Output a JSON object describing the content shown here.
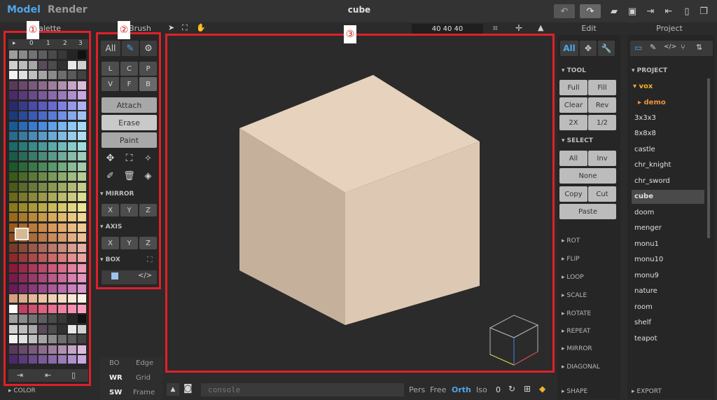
{
  "topbar": {
    "tab_model": "Model",
    "tab_render": "Render",
    "title": "cube"
  },
  "panels": {
    "palette": "Palette",
    "brush": "Brush",
    "edit": "Edit",
    "project": "Project"
  },
  "palette": {
    "tabs": [
      "▸",
      "0",
      "1",
      "2",
      "3"
    ],
    "bottom_label": "COLOR"
  },
  "brush": {
    "filter_all": "All",
    "modes": [
      "L",
      "C",
      "P",
      "V",
      "F",
      "B"
    ],
    "actions": [
      "Attach",
      "Erase",
      "Paint"
    ],
    "mirror_label": "MIRROR",
    "axis_label": "AXIS",
    "box_label": "BOX",
    "xyz": [
      "X",
      "Y",
      "Z"
    ]
  },
  "viewport": {
    "size_readout": "40  40  40"
  },
  "bottom_left": {
    "bo": "BO",
    "edge": "Edge",
    "wr": "WR",
    "grid": "Grid",
    "sw": "SW",
    "frame": "Frame"
  },
  "console": {
    "placeholder": "console",
    "pers": "Pers",
    "free": "Free",
    "orth": "Orth",
    "iso": "Iso",
    "zero": "0"
  },
  "edit": {
    "filter_all": "All",
    "tool_label": "TOOL",
    "tool_buttons": [
      "Full",
      "Fill",
      "Clear",
      "Rev",
      "2X",
      "1/2"
    ],
    "select_label": "SELECT",
    "select_buttons": [
      "All",
      "Inv",
      "None",
      "Copy",
      "Cut",
      "Paste"
    ],
    "sections": [
      "ROT",
      "FLIP",
      "LOOP",
      "SCALE",
      "ROTATE",
      "REPEAT",
      "MIRROR",
      "DIAGONAL",
      "SHAPE"
    ]
  },
  "project": {
    "section_label": "PROJECT",
    "folder": "vox",
    "subfolder": "demo",
    "items": [
      "3x3x3",
      "8x8x8",
      "castle",
      "chr_knight",
      "chr_sword",
      "cube",
      "doom",
      "menger",
      "monu1",
      "monu10",
      "monu9",
      "nature",
      "room",
      "shelf",
      "teapot"
    ],
    "selected": "cube",
    "export_label": "EXPORT"
  },
  "annotations": [
    "①",
    "②",
    "③"
  ],
  "colors": {
    "accent": "#4ea6ea",
    "highlight": "#e02028",
    "folder": "#f0b030",
    "cube_top": "#e6d2bd",
    "cube_left": "#c5b19b",
    "cube_right": "#ddc9b3"
  }
}
